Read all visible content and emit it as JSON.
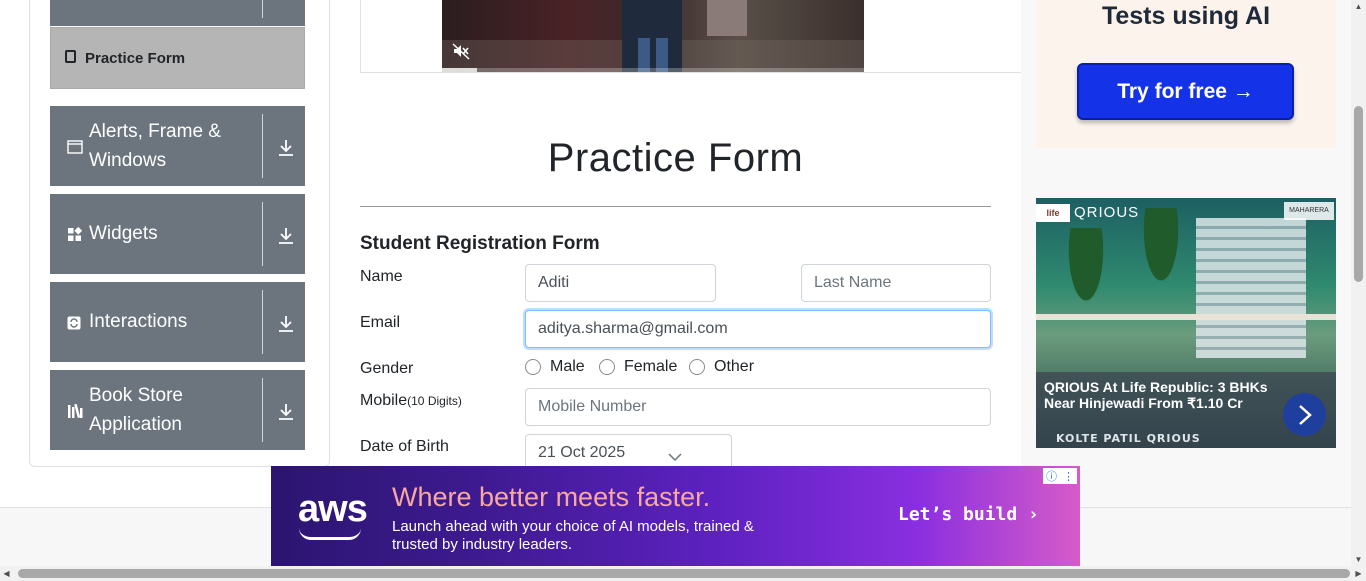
{
  "sidebar": {
    "active_item": "Practice Form",
    "groups": [
      {
        "label": "Alerts, Frame & Windows"
      },
      {
        "label": "Widgets"
      },
      {
        "label": "Interactions"
      },
      {
        "label": "Book Store Application"
      }
    ]
  },
  "main": {
    "title": "Practice Form",
    "form_title": "Student Registration Form",
    "labels": {
      "name": "Name",
      "email": "Email",
      "gender": "Gender",
      "mobile": "Mobile",
      "mobile_hint": "(10 Digits)",
      "dob": "Date of Birth"
    },
    "fields": {
      "first_name_value": "Aditi",
      "last_name_placeholder": "Last Name",
      "email_value": "aditya.sharma@gmail.com",
      "mobile_placeholder": "Mobile Number",
      "dob_value": "21 Oct 2025"
    },
    "gender_options": [
      "Male",
      "Female",
      "Other"
    ]
  },
  "ads": {
    "top": {
      "heading": "Tests using AI",
      "button": "Try for free →"
    },
    "middle": {
      "logo": "QRIOUS",
      "caption": "QRIOUS At Life Republic: 3 BHKs Near Hinjewadi From ₹1.10 Cr",
      "brand": "KOLTE PATIL QRIOUS"
    },
    "bottom": {
      "logo": "aws",
      "headline": "Where better meets faster.",
      "subtext": "Launch ahead with your choice of AI models, trained & trusted by industry leaders.",
      "cta": "Let’s build ›"
    }
  },
  "colors": {
    "sidebar_group_bg": "#6c757d",
    "sidebar_active_bg": "#b5b5b5",
    "ad_button_blue": "#1433e8",
    "input_focus_border": "#80bdff"
  }
}
